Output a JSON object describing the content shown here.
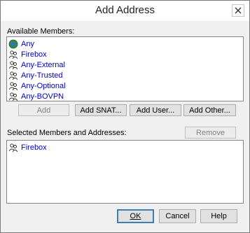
{
  "window": {
    "title": "Add Address"
  },
  "available": {
    "label": "Available Members:",
    "items": [
      {
        "label": "Any",
        "icon": "globe-icon"
      },
      {
        "label": "Firebox",
        "icon": "user-group-icon"
      },
      {
        "label": "Any-External",
        "icon": "user-group-icon"
      },
      {
        "label": "Any-Trusted",
        "icon": "user-group-icon"
      },
      {
        "label": "Any-Optional",
        "icon": "user-group-icon"
      },
      {
        "label": "Any-BOVPN",
        "icon": "user-group-icon"
      }
    ]
  },
  "buttons": {
    "add": "Add",
    "add_snat": "Add SNAT...",
    "add_user": "Add User...",
    "add_other": "Add Other...",
    "remove": "Remove",
    "ok": "OK",
    "cancel": "Cancel",
    "help": "Help"
  },
  "selected": {
    "label": "Selected Members and Addresses:",
    "items": [
      {
        "label": "Firebox",
        "icon": "user-group-icon"
      }
    ]
  },
  "colors": {
    "item_text": "#0000cc",
    "window_bg": "#f0f0f0"
  }
}
